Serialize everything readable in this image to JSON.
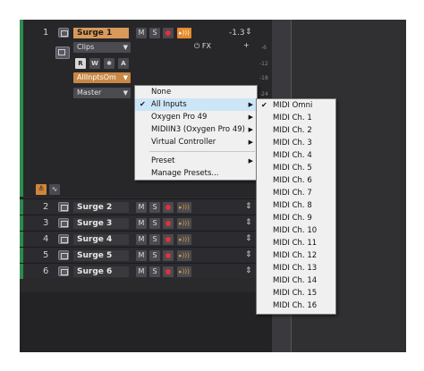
{
  "track1": {
    "number": "1",
    "name": "Surge 1",
    "volume": "-1.3",
    "clips_label": "Clips",
    "rwxa": [
      "R",
      "W",
      "✱",
      "A"
    ],
    "input_label": "AllInptsOm",
    "output_label": "Master",
    "fx_label": "FX",
    "mute": "M",
    "solo": "S",
    "scale": [
      "-6",
      "-12",
      "-18",
      "-24"
    ]
  },
  "tracks": [
    {
      "number": "2",
      "name": "Surge 2"
    },
    {
      "number": "3",
      "name": "Surge 3"
    },
    {
      "number": "4",
      "name": "Surge 4"
    },
    {
      "number": "5",
      "name": "Surge 5"
    },
    {
      "number": "6",
      "name": "Surge 6"
    }
  ],
  "input_menu": {
    "items": [
      {
        "label": "None",
        "checked": false,
        "submenu": false
      },
      {
        "label": "All Inputs",
        "checked": true,
        "submenu": true
      },
      {
        "label": "Oxygen Pro 49",
        "checked": false,
        "submenu": true
      },
      {
        "label": "MIDIIN3 (Oxygen Pro 49)",
        "checked": false,
        "submenu": true
      },
      {
        "label": "Virtual Controller",
        "checked": false,
        "submenu": true
      }
    ],
    "preset_items": [
      {
        "label": "Preset",
        "submenu": true
      },
      {
        "label": "Manage Presets...",
        "submenu": false
      }
    ]
  },
  "midi_submenu": {
    "items": [
      "MIDI Omni",
      "MIDI Ch. 1",
      "MIDI Ch. 2",
      "MIDI Ch. 3",
      "MIDI Ch. 4",
      "MIDI Ch. 5",
      "MIDI Ch. 6",
      "MIDI Ch. 7",
      "MIDI Ch. 8",
      "MIDI Ch. 9",
      "MIDI Ch. 10",
      "MIDI Ch. 11",
      "MIDI Ch. 12",
      "MIDI Ch. 13",
      "MIDI Ch. 14",
      "MIDI Ch. 15",
      "MIDI Ch. 16"
    ],
    "checked_index": 0
  }
}
